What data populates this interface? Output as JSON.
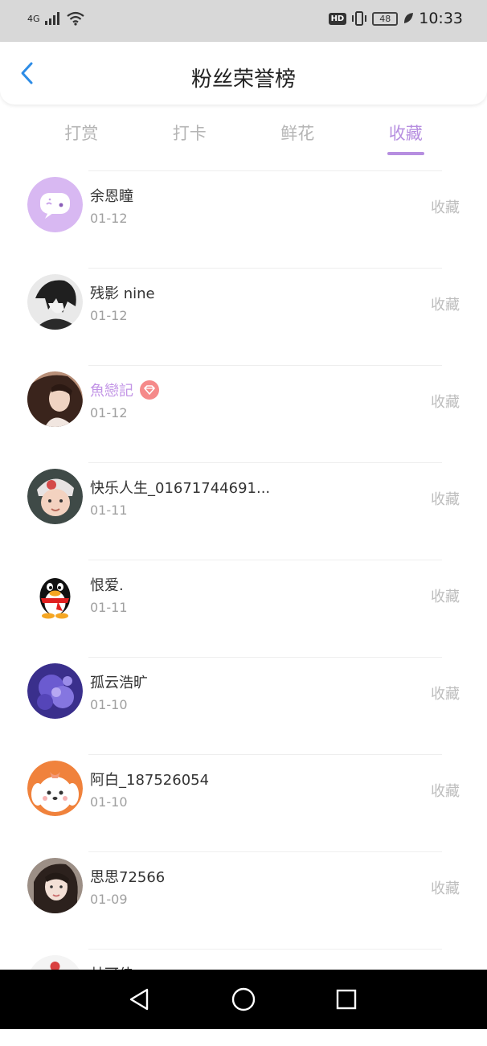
{
  "status_bar": {
    "network": "4G",
    "hd": "HD",
    "battery": "48",
    "time": "10:33"
  },
  "header": {
    "title": "粉丝荣誉榜",
    "back_icon": "chevron-left-icon"
  },
  "tabs": [
    {
      "label": "打赏",
      "active": false
    },
    {
      "label": "打卡",
      "active": false
    },
    {
      "label": "鲜花",
      "active": false
    },
    {
      "label": "收藏",
      "active": true
    }
  ],
  "colors": {
    "accent": "#b68ee0",
    "vip_badge": "#f58a8a"
  },
  "fans": [
    {
      "name": "余恩瞳",
      "date": "01-12",
      "action": "收藏",
      "vip": false,
      "avatar": "chat-bubble-avatar"
    },
    {
      "name": "残影 nine",
      "date": "01-12",
      "action": "收藏",
      "vip": false,
      "avatar": "dark-anime-avatar"
    },
    {
      "name": "魚戀記",
      "date": "01-12",
      "action": "收藏",
      "vip": true,
      "avatar": "girl-photo-avatar"
    },
    {
      "name": "快乐人生_01671744691...",
      "date": "01-11",
      "action": "收藏",
      "vip": false,
      "avatar": "baby-photo-avatar"
    },
    {
      "name": "恨爱.",
      "date": "01-11",
      "action": "收藏",
      "vip": false,
      "avatar": "qq-penguin-avatar"
    },
    {
      "name": "孤云浩旷",
      "date": "01-10",
      "action": "收藏",
      "vip": false,
      "avatar": "purple-flower-avatar"
    },
    {
      "name": "阿白_187526054",
      "date": "01-10",
      "action": "收藏",
      "vip": false,
      "avatar": "cartoon-dog-avatar"
    },
    {
      "name": "思思72566",
      "date": "01-09",
      "action": "收藏",
      "vip": false,
      "avatar": "girl-photo-avatar"
    }
  ],
  "partial_row": {
    "name": "林可佳"
  }
}
